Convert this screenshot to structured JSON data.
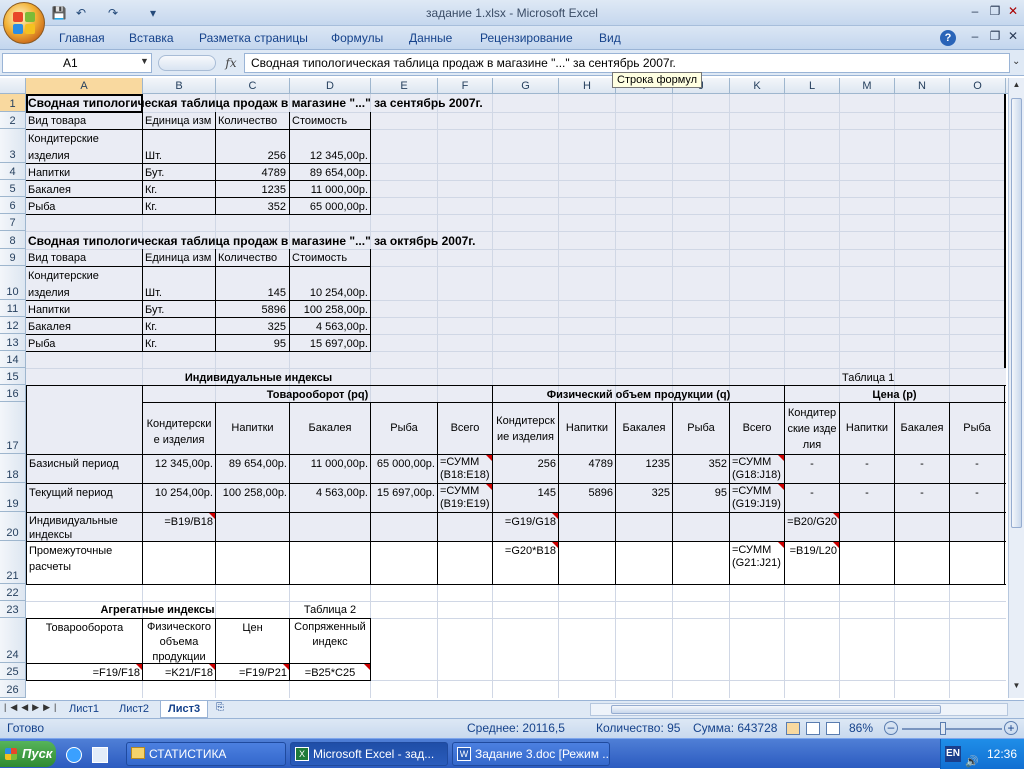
{
  "window": {
    "title": "задание 1.xlsx - Microsoft Excel"
  },
  "qat": {
    "save": "💾",
    "undo": "↶",
    "redo": "↷",
    "more": "▾"
  },
  "ribbon": {
    "tabs": [
      "Главная",
      "Вставка",
      "Разметка страницы",
      "Формулы",
      "Данные",
      "Рецензирование",
      "Вид"
    ]
  },
  "formula_bar": {
    "name_box": "A1",
    "fx": "fx",
    "content": "Сводная типологическая таблица продаж в магазине \"...\" за сентябрь 2007г.",
    "tooltip": "Строка формул"
  },
  "columns": [
    "A",
    "B",
    "C",
    "D",
    "E",
    "F",
    "G",
    "H",
    "I",
    "J",
    "K",
    "L",
    "M",
    "N",
    "O"
  ],
  "rows": [
    "1",
    "2",
    "3",
    "4",
    "5",
    "6",
    "7",
    "8",
    "9",
    "10",
    "11",
    "12",
    "13",
    "14",
    "15",
    "16",
    "17",
    "18",
    "19",
    "20",
    "21",
    "22",
    "23",
    "24",
    "25",
    "26"
  ],
  "cells": {
    "A1": "Сводная типологическая таблица продаж в магазине \"...\" за сентябрь 2007г.",
    "A2": "Вид товара",
    "B2": "Единица изм",
    "C2": "Количество",
    "D2": "Стоимость",
    "A3": "Кондитерские изделия",
    "B3": "Шт.",
    "C3": "256",
    "D3": "12 345,00р.",
    "A4": "Напитки",
    "B4": "Бут.",
    "C4": "4789",
    "D4": "89 654,00р.",
    "A5": "Бакалея",
    "B5": "Кг.",
    "C5": "1235",
    "D5": "11 000,00р.",
    "A6": "Рыба",
    "B6": "Кг.",
    "C6": "352",
    "D6": "65 000,00р.",
    "A8": "Сводная типологическая таблица продаж в магазине \"...\" за октябрь 2007г.",
    "A9": "Вид товара",
    "B9": "Единица изм",
    "C9": "Количество",
    "D9": "Стоимость",
    "A10": "Кондитерские изделия",
    "B10": "Шт.",
    "C10": "145",
    "D10": "10 254,00р.",
    "A11": "Напитки",
    "B11": "Бут.",
    "C11": "5896",
    "D11": "100 258,00р.",
    "A12": "Бакалея",
    "B12": "Кг.",
    "C12": "325",
    "D12": "4 563,00р.",
    "A13": "Рыба",
    "B13": "Кг.",
    "C13": "95",
    "D13": "15 697,00р.",
    "B15": "Индивидуальные индексы",
    "L15": "Таблица 1",
    "B16": "Товарооборот (pq)",
    "G16": "Физический объем продукции (q)",
    "L16": "Цена (p)",
    "B17": "Кондитерские изделия",
    "C17": "Напитки",
    "D17": "Бакалея",
    "E17": "Рыба",
    "F17": "Всего",
    "G17": "Кондитерские изделия",
    "H17": "Напитки",
    "I17": "Бакалея",
    "J17": "Рыба",
    "K17": "Всего",
    "L17": "Кондитерские изделия",
    "M17": "Напитки",
    "N17": "Бакалея",
    "O17": "Рыба",
    "A18": "Базисный период",
    "B18": "12 345,00р.",
    "C18": "89 654,00р.",
    "D18": "11 000,00р.",
    "E18": "65 000,00р.",
    "F18": "=СУММ(B18:E18)",
    "G18": "256",
    "H18": "4789",
    "I18": "1235",
    "J18": "352",
    "K18": "=СУММ(G18:J18)",
    "L18": "-",
    "M18": "-",
    "N18": "-",
    "O18": "-",
    "A19": "Текущий период",
    "B19": "10 254,00р.",
    "C19": "100 258,00р.",
    "D19": "4 563,00р.",
    "E19": "15 697,00р.",
    "F19": "=СУММ(B19:E19)",
    "G19": "145",
    "H19": "5896",
    "I19": "325",
    "J19": "95",
    "K19": "=СУММ(G19:J19)",
    "L19": "-",
    "M19": "-",
    "N19": "-",
    "O19": "-",
    "A20": "Индивидуальные индексы",
    "B20": "=B19/B18",
    "G20": "=G19/G18",
    "L20": "=B20/G20",
    "A21": "Промежуточные расчеты",
    "G21": "=G20*B18",
    "K21": "=СУММ(G21:J21)",
    "L21": "=B19/L20",
    "B23": "Агрегатные индексы",
    "D23": "Таблица 2",
    "A24": "Товарооборота",
    "B24": "Физического объема продукции",
    "C24": "Цен",
    "D24": "Сопряженный индекс",
    "A25": "=F19/F18",
    "B25": "=K21/F18",
    "C25": "=F19/P21",
    "D25": "=B25*C25"
  },
  "sheets": [
    "Лист1",
    "Лист2",
    "Лист3"
  ],
  "status": {
    "ready": "Готово",
    "average": "Среднее: 20116,5",
    "count": "Количество: 95",
    "sum": "Сумма: 643728",
    "zoom": "86%"
  },
  "taskbar": {
    "start": "Пуск",
    "tasks": [
      "СТАТИСТИКА",
      "Microsoft Excel - зад...",
      "Задание 3.doc [Режим ..."
    ],
    "lang": "EN",
    "time": "12:36"
  }
}
